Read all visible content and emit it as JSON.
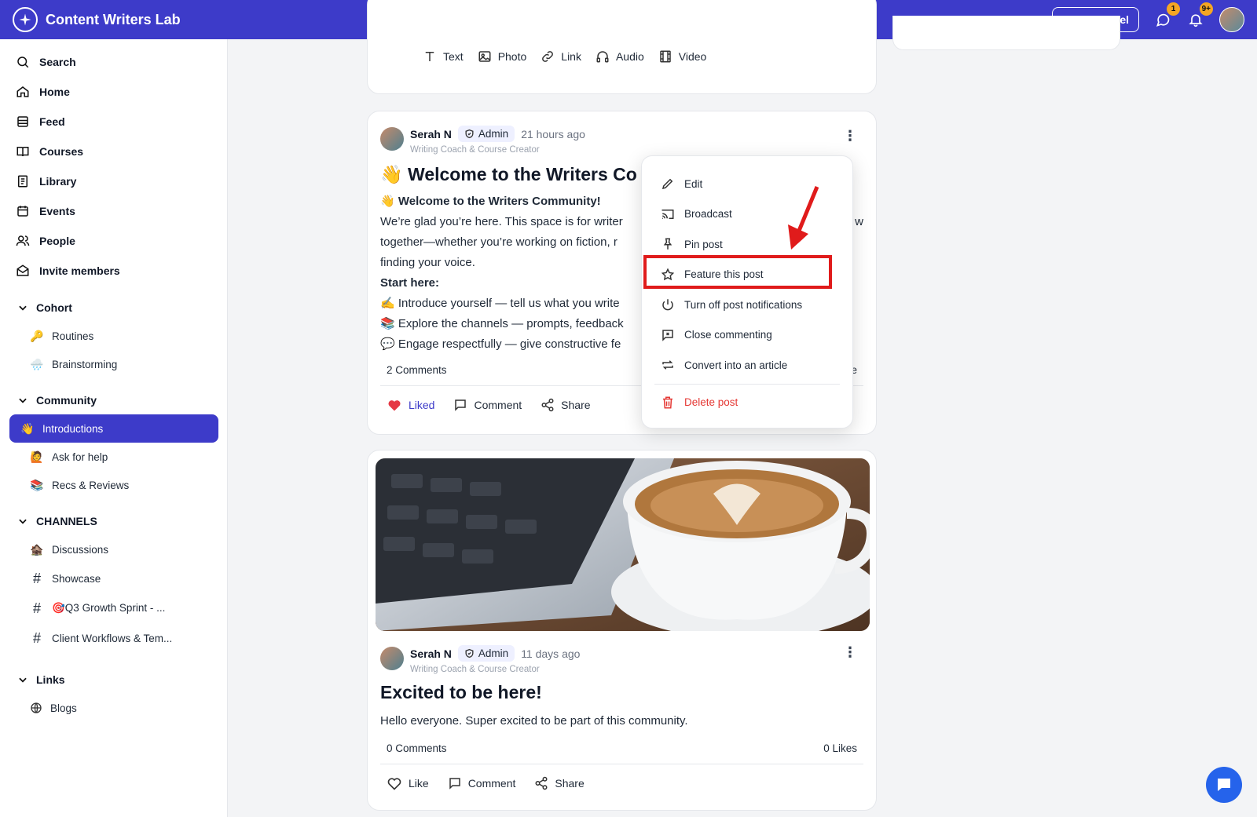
{
  "topbar": {
    "brand": "Content Writers Lab",
    "admin_panel": "Admin Panel",
    "chat_badge": "1",
    "notif_badge": "9+"
  },
  "sidebar": {
    "nav": [
      {
        "label": "Search",
        "icon": "search-icon"
      },
      {
        "label": "Home",
        "icon": "home-icon"
      },
      {
        "label": "Feed",
        "icon": "feed-icon"
      },
      {
        "label": "Courses",
        "icon": "book-icon"
      },
      {
        "label": "Library",
        "icon": "library-icon"
      },
      {
        "label": "Events",
        "icon": "calendar-icon"
      },
      {
        "label": "People",
        "icon": "people-icon"
      },
      {
        "label": "Invite members",
        "icon": "mail-icon"
      }
    ],
    "cohort": {
      "title": "Cohort",
      "items": [
        {
          "emoji": "🔑",
          "label": "Routines"
        },
        {
          "emoji": "🌧️",
          "label": "Brainstorming"
        }
      ]
    },
    "community": {
      "title": "Community",
      "items": [
        {
          "emoji": "👋",
          "label": "Introductions"
        },
        {
          "emoji": "🙋",
          "label": "Ask for help"
        },
        {
          "emoji": "📚",
          "label": "Recs & Reviews"
        }
      ]
    },
    "channels": {
      "title": "CHANNELS",
      "items": [
        {
          "emoji": "🏚️",
          "label": "Discussions"
        },
        {
          "emoji": "#",
          "label": "Showcase"
        },
        {
          "emoji": "#",
          "label": "🎯Q3 Growth Sprint - ..."
        },
        {
          "emoji": "#",
          "label": "Client Workflows & Tem..."
        }
      ]
    },
    "links": {
      "title": "Links",
      "items": [
        {
          "label": "Blogs"
        }
      ]
    }
  },
  "composer": {
    "options": [
      "Text",
      "Photo",
      "Link",
      "Audio",
      "Video"
    ]
  },
  "post1": {
    "author": "Serah N",
    "role": "Admin",
    "time": "21 hours ago",
    "subtitle": "Writing Coach & Course Creator",
    "title": "👋 Welcome to the Writers Co",
    "lines": [
      "👋 Welcome to the Writers Community!",
      "We’re glad you’re here. This space is for writer",
      "together—whether you’re working on fiction, r",
      "finding your voice.",
      "Start here:",
      "✍️ Introduce yourself — tell us what you write",
      "📚 Explore the channels — prompts, feedback",
      "💬 Engage respectfully — give constructive fe"
    ],
    "comments": "2 Comments",
    "liked": "Liked",
    "comment": "Comment",
    "share": "Share",
    "tail_char": "w",
    "tail_char2": "e"
  },
  "post2": {
    "author": "Serah N",
    "role": "Admin",
    "time": "11 days ago",
    "subtitle": "Writing Coach & Course Creator",
    "title": "Excited to be here!",
    "body": "Hello everyone. Super excited to be part of this community.",
    "comments": "0 Comments",
    "likes": "0 Likes",
    "like": "Like",
    "comment": "Comment",
    "share": "Share"
  },
  "menu": {
    "items": [
      "Edit",
      "Broadcast",
      "Pin post",
      "Feature this post",
      "Turn off post notifications",
      "Close commenting",
      "Convert into an article"
    ],
    "delete": "Delete post",
    "highlighted": "Feature this post"
  },
  "colors": {
    "brand": "#3d3bc9",
    "highlight": "#e01b1b",
    "danger": "#e53935"
  }
}
